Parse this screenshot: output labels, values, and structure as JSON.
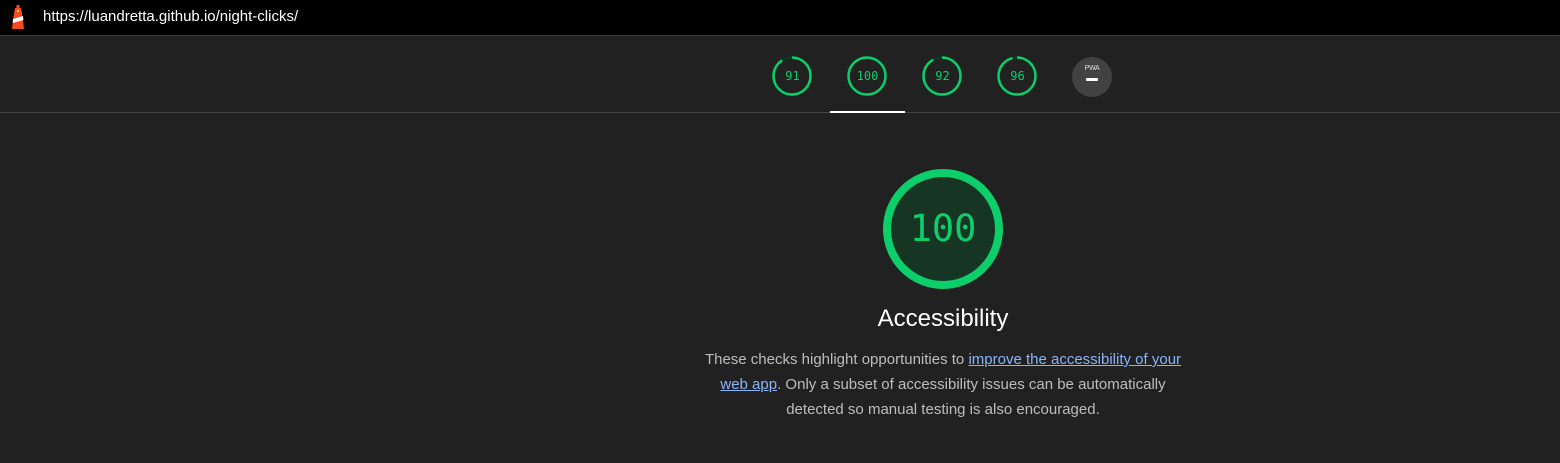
{
  "url_bar": {
    "url": "https://luandretta.github.io/night-clicks/"
  },
  "score_tabs": [
    {
      "label": "91",
      "score": 91
    },
    {
      "label": "100",
      "score": 100
    },
    {
      "label": "92",
      "score": 92
    },
    {
      "label": "96",
      "score": 96
    },
    {
      "label": "PWA",
      "score": null
    }
  ],
  "active_category": {
    "score": "100",
    "title": "Accessibility",
    "description_before": "These checks highlight opportunities to ",
    "description_link": "improve the accessibility of your web app",
    "description_after": ". Only a subset of accessibility issues can be automatically detected so manual testing is also encouraged."
  },
  "colors": {
    "pass": "#0cce6b",
    "link": "#8ab4f8",
    "background": "#212121"
  },
  "icons": {
    "logo": "lighthouse-logo-icon"
  }
}
